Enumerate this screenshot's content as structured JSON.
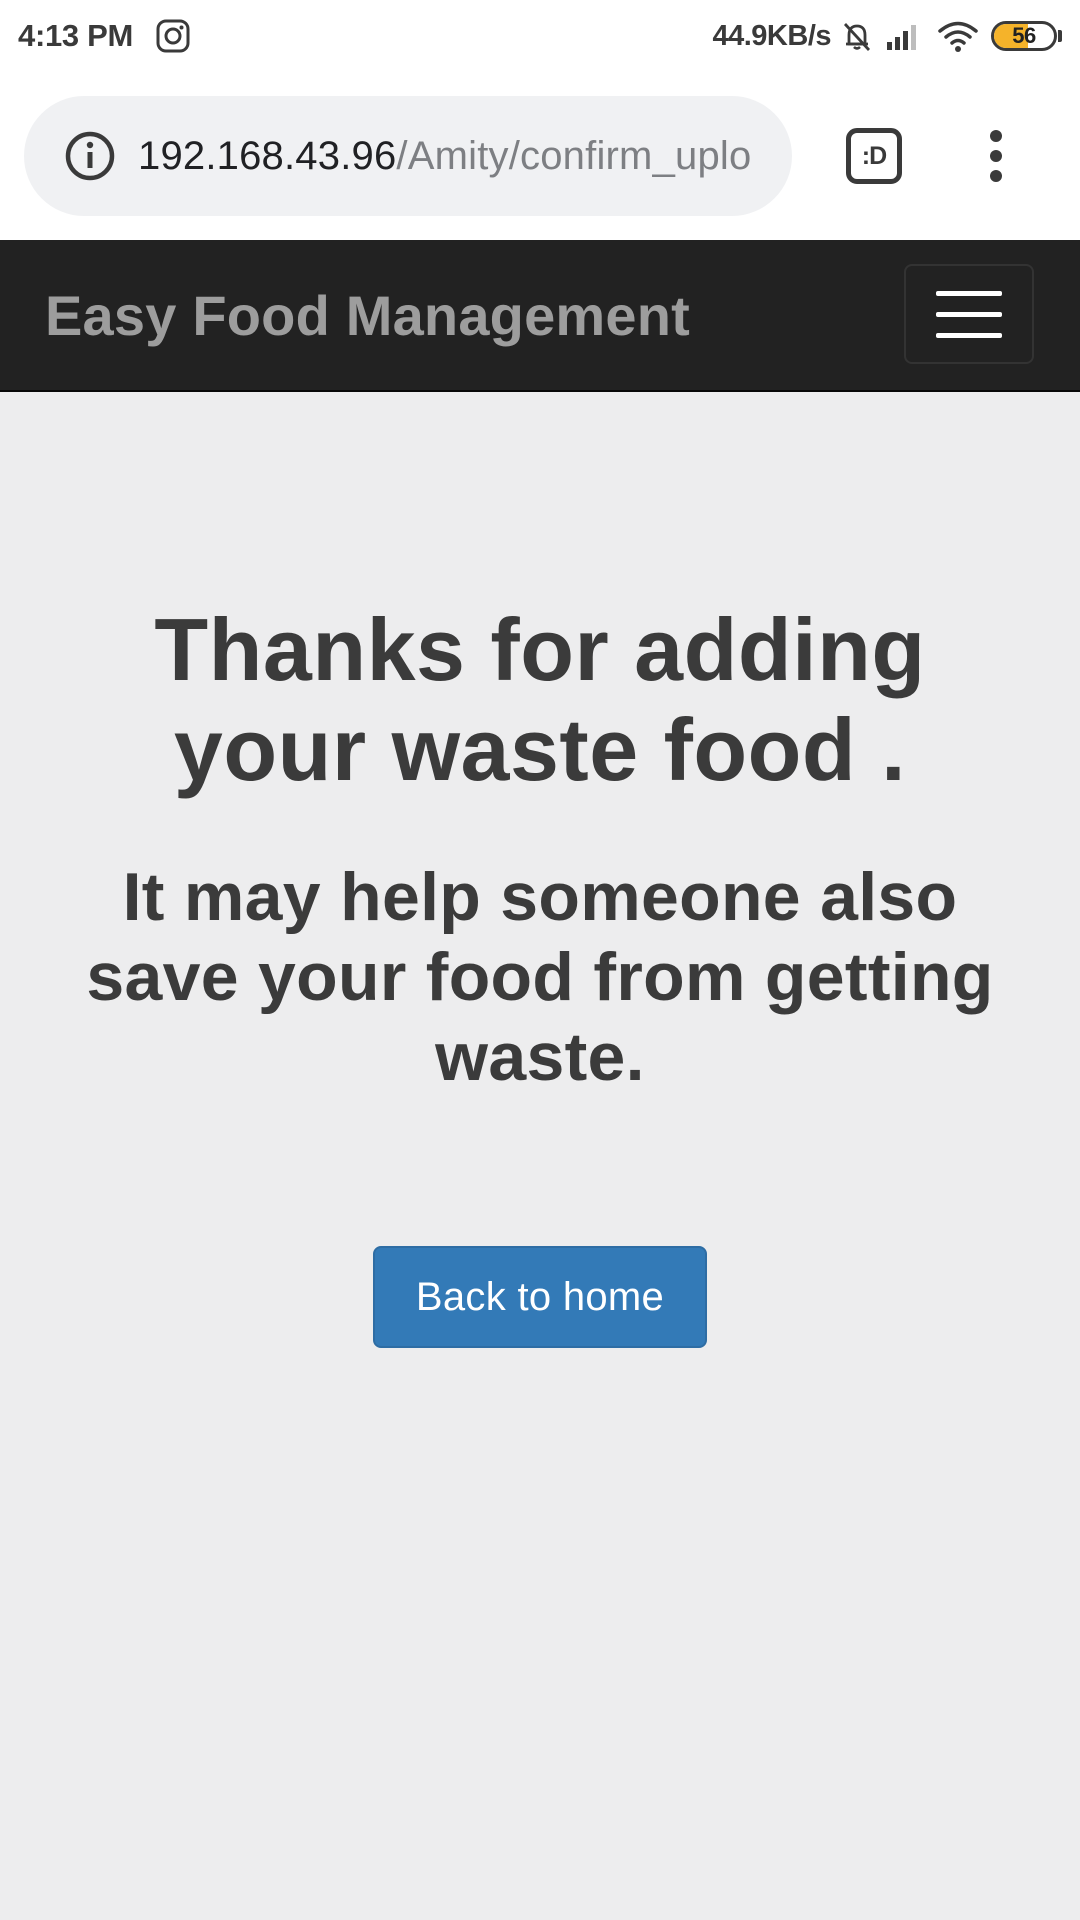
{
  "status_bar": {
    "time": "4:13 PM",
    "notification_icon": "instagram-icon",
    "network_speed": "44.9KB/s",
    "icons": [
      "muted-bell-icon",
      "signal-icon",
      "wifi-icon"
    ],
    "battery_level": "56",
    "battery_fraction": 0.56,
    "battery_color": "#f5b32a"
  },
  "browser": {
    "url_host": "192.168.43.96",
    "url_path": "/Amity/confirm_uplo",
    "info_icon": "info-icon",
    "tab_switcher_label": ":D",
    "menu_icon": "more-vert-icon"
  },
  "navbar": {
    "brand": "Easy Food Management",
    "toggle_icon": "hamburger-icon",
    "background": "#222222",
    "brand_color": "#9d9d9d"
  },
  "main": {
    "heading_line1": "Thanks for adding",
    "heading_line2": "your waste food .",
    "subheading_line1": "It may help someone also",
    "subheading_line2": "save your food from getting",
    "subheading_line3": "waste.",
    "back_button_label": "Back to home",
    "button_color": "#337ab7"
  }
}
